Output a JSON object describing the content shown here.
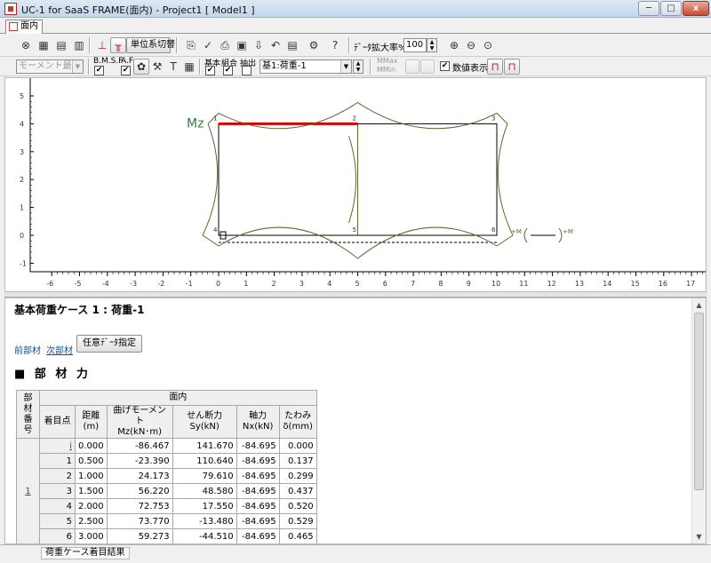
{
  "window": {
    "title": "UC-1 for SaaS FRAME(面内) - Project1 [ Model1 ]",
    "min_glyph": "─",
    "max_glyph": "□",
    "close_glyph": "x"
  },
  "tabs": [
    {
      "label": "面内"
    }
  ],
  "toolbar1": {
    "unit_switch_label": "単位系切替",
    "data_scale_label": "ﾃﾞｰﾀ拡大率%",
    "data_scale_value": "100"
  },
  "toolbar2": {
    "result_select_value": "モーメント最大",
    "bmsf_label": "B.M.S.F",
    "af_label": "A.F",
    "kihon_label": "基本",
    "kumiawase_label": "組合",
    "chuushutsu_label": "抽出",
    "loadcase_value": "基1:荷重-1",
    "mmax_label": "MMax",
    "mmin_label": "MMin",
    "numeric_display_label": "数値表示",
    "numeric_display_checked": "✔"
  },
  "graph": {
    "diagram_label": "Mz",
    "y_ticks": [
      "5",
      "4",
      "3",
      "2",
      "1",
      "0",
      "-1"
    ],
    "x_ticks": [
      "-6",
      "-5",
      "-4",
      "-3",
      "-2",
      "-1",
      "0",
      "1",
      "2",
      "3",
      "4",
      "5",
      "6",
      "7",
      "8",
      "9",
      "10",
      "11",
      "12",
      "13",
      "14",
      "15",
      "16",
      "17"
    ],
    "node_labels": [
      "1",
      "2",
      "3",
      "4",
      "5",
      "6"
    ],
    "moment_plus_label": "+M",
    "moment_plus_label2": "+M"
  },
  "lower": {
    "section_title": "基本荷重ケース 1 : 荷重-1",
    "prev_member_link": "前部材",
    "next_member_link": "次部材",
    "arbitrary_button": "任意ﾃﾞｰﾀ指定",
    "heading": "■ 部 材 力",
    "table": {
      "group_header": "面内",
      "headers": {
        "member_no": "部材\n番号",
        "point": "着目点",
        "distance": "距離\n(m)",
        "moment": "曲げモーメント\nMz(kN･m)",
        "shear": "せん断力\nSy(kN)",
        "axial": "軸力\nNx(kN)",
        "deflection": "たわみ\nδ(mm)"
      },
      "member_no": "1",
      "rows": [
        {
          "point": "i",
          "distance": "0.000",
          "moment": "-86.467",
          "shear": "141.670",
          "axial": "-84.695",
          "deflection": "0.000"
        },
        {
          "point": "1",
          "distance": "0.500",
          "moment": "-23.390",
          "shear": "110.640",
          "axial": "-84.695",
          "deflection": "0.137"
        },
        {
          "point": "2",
          "distance": "1.000",
          "moment": "24.173",
          "shear": "79.610",
          "axial": "-84.695",
          "deflection": "0.299"
        },
        {
          "point": "3",
          "distance": "1.500",
          "moment": "56.220",
          "shear": "48.580",
          "axial": "-84.695",
          "deflection": "0.437"
        },
        {
          "point": "4",
          "distance": "2.000",
          "moment": "72.753",
          "shear": "17.550",
          "axial": "-84.695",
          "deflection": "0.520"
        },
        {
          "point": "5",
          "distance": "2.500",
          "moment": "73.770",
          "shear": "-13.480",
          "axial": "-84.695",
          "deflection": "0.529"
        },
        {
          "point": "6",
          "distance": "3.000",
          "moment": "59.273",
          "shear": "-44.510",
          "axial": "-84.695",
          "deflection": "0.465"
        }
      ]
    }
  },
  "statusbar": {
    "text": "荷重ケース着目結果"
  },
  "colors": {
    "frame": "#000000",
    "diagram": "#556b2f",
    "highlight": "#d40000",
    "link": "#1a4f8a"
  }
}
